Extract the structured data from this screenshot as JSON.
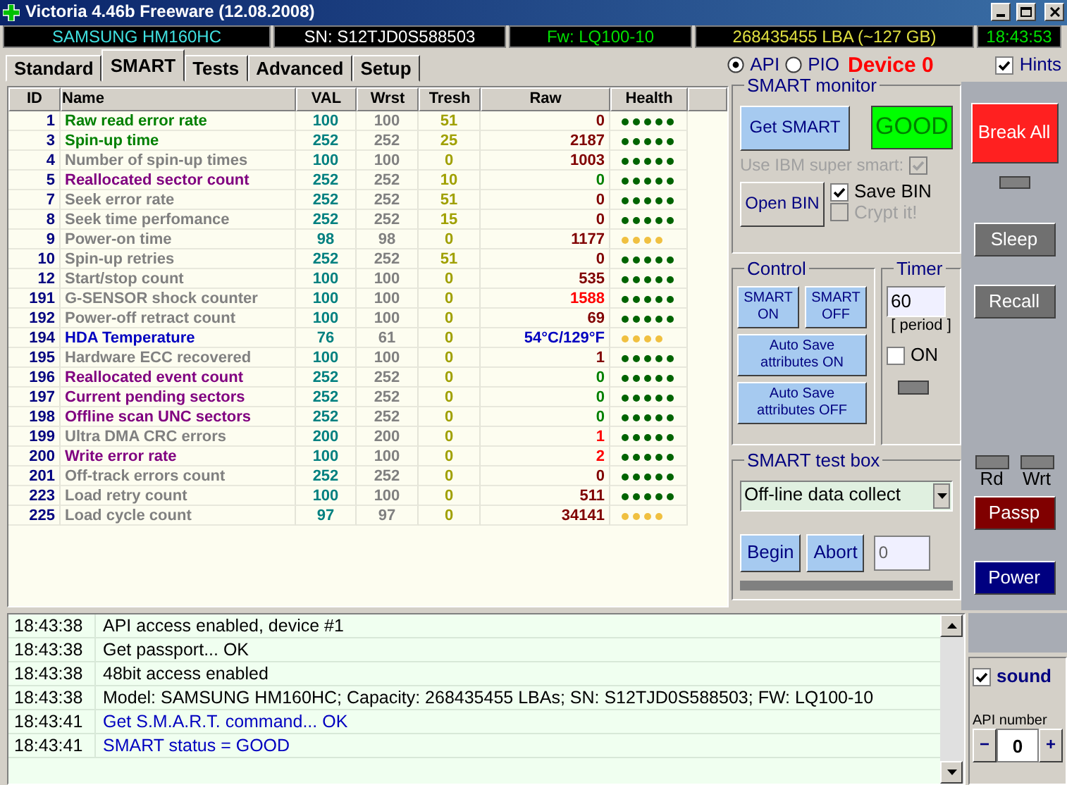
{
  "window": {
    "title": "Victoria 4.46b Freeware (12.08.2008)"
  },
  "info_bar": {
    "model": "SAMSUNG HM160HC",
    "serial": "SN: S12TJD0S588503",
    "firmware": "Fw: LQ100-10",
    "capacity": "268435455 LBA (~127 GB)",
    "time": "18:43:53"
  },
  "tabs": [
    {
      "label": "Standard",
      "selected": false
    },
    {
      "label": "SMART",
      "selected": true
    },
    {
      "label": "Tests",
      "selected": false
    },
    {
      "label": "Advanced",
      "selected": false
    },
    {
      "label": "Setup",
      "selected": false
    }
  ],
  "access_modes": [
    {
      "label": "API",
      "selected": true
    },
    {
      "label": "PIO",
      "selected": false
    }
  ],
  "device": "Device 0",
  "hints": {
    "label": "Hints",
    "checked": true
  },
  "smart_table": {
    "columns": [
      "ID",
      "Name",
      "VAL",
      "Wrst",
      "Tresh",
      "Raw",
      "Health"
    ],
    "rows": [
      {
        "id": "1",
        "name": "Raw read error rate",
        "color": "#008000",
        "val": "100",
        "wrst": "100",
        "tresh": "51",
        "raw": {
          "text": "0",
          "color": "#800000"
        },
        "stars": 5
      },
      {
        "id": "3",
        "name": "Spin-up time",
        "color": "#008000",
        "val": "252",
        "wrst": "252",
        "tresh": "25",
        "raw": {
          "text": "2187",
          "color": "#800000"
        },
        "stars": 5
      },
      {
        "id": "4",
        "name": "Number of spin-up times",
        "color": "#808080",
        "val": "100",
        "wrst": "100",
        "tresh": "0",
        "raw": {
          "text": "1003",
          "color": "#800000"
        },
        "stars": 5
      },
      {
        "id": "5",
        "name": "Reallocated sector count",
        "color": "#800080",
        "val": "252",
        "wrst": "252",
        "tresh": "10",
        "raw": {
          "text": "0",
          "color": "#008000"
        },
        "stars": 5
      },
      {
        "id": "7",
        "name": "Seek error rate",
        "color": "#808080",
        "val": "252",
        "wrst": "252",
        "tresh": "51",
        "raw": {
          "text": "0",
          "color": "#800000"
        },
        "stars": 5
      },
      {
        "id": "8",
        "name": "Seek time perfomance",
        "color": "#808080",
        "val": "252",
        "wrst": "252",
        "tresh": "15",
        "raw": {
          "text": "0",
          "color": "#800000"
        },
        "stars": 5
      },
      {
        "id": "9",
        "name": "Power-on time",
        "color": "#808080",
        "val": "98",
        "wrst": "98",
        "tresh": "0",
        "raw": {
          "text": "1177",
          "color": "#800000"
        },
        "stars": 4
      },
      {
        "id": "10",
        "name": "Spin-up retries",
        "color": "#808080",
        "val": "252",
        "wrst": "252",
        "tresh": "51",
        "raw": {
          "text": "0",
          "color": "#800000"
        },
        "stars": 5
      },
      {
        "id": "12",
        "name": "Start/stop count",
        "color": "#808080",
        "val": "100",
        "wrst": "100",
        "tresh": "0",
        "raw": {
          "text": "535",
          "color": "#800000"
        },
        "stars": 5
      },
      {
        "id": "191",
        "name": "G-SENSOR shock counter",
        "color": "#808080",
        "val": "100",
        "wrst": "100",
        "tresh": "0",
        "raw": {
          "text": "1588",
          "color": "#ff0000"
        },
        "stars": 5
      },
      {
        "id": "192",
        "name": "Power-off retract count",
        "color": "#808080",
        "val": "100",
        "wrst": "100",
        "tresh": "0",
        "raw": {
          "text": "69",
          "color": "#800000"
        },
        "stars": 5
      },
      {
        "id": "194",
        "name": "HDA Temperature",
        "color": "#0000c0",
        "val": "76",
        "wrst": "61",
        "tresh": "0",
        "raw": {
          "text": "54°C/129°F",
          "color": "#0000c0"
        },
        "stars": 4
      },
      {
        "id": "195",
        "name": "Hardware ECC recovered",
        "color": "#808080",
        "val": "100",
        "wrst": "100",
        "tresh": "0",
        "raw": {
          "text": "1",
          "color": "#800000"
        },
        "stars": 5
      },
      {
        "id": "196",
        "name": "Reallocated event count",
        "color": "#800080",
        "val": "252",
        "wrst": "252",
        "tresh": "0",
        "raw": {
          "text": "0",
          "color": "#008000"
        },
        "stars": 5
      },
      {
        "id": "197",
        "name": "Current pending sectors",
        "color": "#800080",
        "val": "252",
        "wrst": "252",
        "tresh": "0",
        "raw": {
          "text": "0",
          "color": "#008000"
        },
        "stars": 5
      },
      {
        "id": "198",
        "name": "Offline scan UNC sectors",
        "color": "#800080",
        "val": "252",
        "wrst": "252",
        "tresh": "0",
        "raw": {
          "text": "0",
          "color": "#008000"
        },
        "stars": 5
      },
      {
        "id": "199",
        "name": "Ultra DMA CRC errors",
        "color": "#808080",
        "val": "200",
        "wrst": "200",
        "tresh": "0",
        "raw": {
          "text": "1",
          "color": "#ff0000"
        },
        "stars": 5
      },
      {
        "id": "200",
        "name": "Write error rate",
        "color": "#800080",
        "val": "100",
        "wrst": "100",
        "tresh": "0",
        "raw": {
          "text": "2",
          "color": "#ff0000"
        },
        "stars": 5
      },
      {
        "id": "201",
        "name": "Off-track errors count",
        "color": "#808080",
        "val": "252",
        "wrst": "252",
        "tresh": "0",
        "raw": {
          "text": "0",
          "color": "#800000"
        },
        "stars": 5
      },
      {
        "id": "223",
        "name": "Load retry count",
        "color": "#808080",
        "val": "100",
        "wrst": "100",
        "tresh": "0",
        "raw": {
          "text": "511",
          "color": "#800000"
        },
        "stars": 5
      },
      {
        "id": "225",
        "name": "Load cycle count",
        "color": "#808080",
        "val": "97",
        "wrst": "97",
        "tresh": "0",
        "raw": {
          "text": "34141",
          "color": "#800000"
        },
        "stars": 4
      }
    ]
  },
  "smart_monitor": {
    "title": "SMART monitor",
    "get_button": "Get SMART",
    "status": "GOOD",
    "ibm": {
      "label": "Use IBM super smart:",
      "checked": true
    },
    "open_bin": "Open BIN",
    "save_bin": {
      "label": "Save BIN",
      "checked": true
    },
    "crypt": {
      "label": "Crypt it!",
      "checked": false
    }
  },
  "control": {
    "title": "Control",
    "buttons": [
      {
        "label": "SMART ON",
        "kind": "small"
      },
      {
        "label": "SMART OFF",
        "kind": "small"
      },
      {
        "label": "Auto Save attributes ON",
        "kind": "wide"
      },
      {
        "label": "Auto Save attributes OFF",
        "kind": "wide"
      }
    ]
  },
  "timer": {
    "title": "Timer",
    "value": "60",
    "caption": "[ period ]",
    "on": {
      "label": "ON",
      "checked": false
    }
  },
  "test_box": {
    "title": "SMART test box",
    "mode": "Off-line data collect",
    "begin": "Begin",
    "abort": "Abort",
    "value": "0",
    "progress": {
      "level": 0
    }
  },
  "side_buttons": [
    {
      "label": "Break All",
      "kind": "red"
    },
    {
      "label": "Sleep",
      "kind": "grey"
    },
    {
      "label": "Recall",
      "kind": "grey"
    },
    {
      "label": "Passp",
      "kind": "maroon"
    },
    {
      "label": "Power",
      "kind": "navy"
    }
  ],
  "indicators": [
    {
      "label": "Rd"
    },
    {
      "label": "Wrt"
    }
  ],
  "log": [
    {
      "time": "18:43:38",
      "text": "API access enabled, device #1",
      "color": "#000000"
    },
    {
      "time": "18:43:38",
      "text": "Get passport... OK",
      "color": "#000000"
    },
    {
      "time": "18:43:38",
      "text": "48bit access enabled",
      "color": "#000000"
    },
    {
      "time": "18:43:38",
      "text": "Model: SAMSUNG HM160HC; Capacity: 268435455 LBAs; SN: S12TJD0S588503; FW: LQ100-10",
      "color": "#000000"
    },
    {
      "time": "18:43:41",
      "text": "Get S.M.A.R.T. command... OK",
      "color": "#0000c0"
    },
    {
      "time": "18:43:41",
      "text": "SMART status = GOOD",
      "color": "#0000c0"
    }
  ],
  "sound": {
    "label": "sound",
    "checked": true
  },
  "api_number": {
    "label": "API number",
    "value": "0",
    "minus": "−",
    "plus": "+"
  }
}
